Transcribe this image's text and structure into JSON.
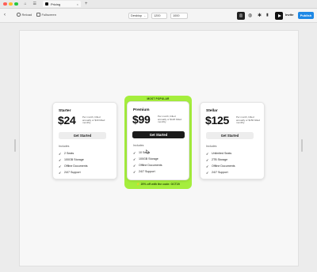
{
  "window": {
    "traffic_colors": [
      "#ff5f57",
      "#febc2e",
      "#28c840"
    ],
    "tab_title": "Pricing"
  },
  "toolbar": {
    "reload_label": "Reload",
    "fullscreen_label": "Fullscreen",
    "device_select": "Desktop",
    "width_value": "1200",
    "height_value": "1000",
    "invite_label": "Invite",
    "publish_label": "Publish",
    "publish_color": "#1e88e5"
  },
  "plans": [
    {
      "name": "Starter",
      "price": "$24",
      "note": "Per month, billed annually or $40 billed monthly",
      "cta": "Get Started",
      "includes_label": "Includes",
      "features": [
        "2 Seats",
        "100GB Storage",
        "Offline Documents",
        "24/7 Support"
      ]
    },
    {
      "name": "Premium",
      "price": "$99",
      "note": "Per month, billed annually or $120 billed monthly",
      "cta": "Get Started",
      "includes_label": "Includes",
      "features": [
        "10 Seats",
        "100GB Storage",
        "Offline Documents",
        "24/7 Support"
      ]
    },
    {
      "name": "Stellar",
      "price": "$125",
      "note": "Per month, billed annually or $150 billed monthly",
      "cta": "Get Started",
      "includes_label": "Includes",
      "features": [
        "Unlimited Seats",
        "2TB Storage",
        "Offline Documents",
        "24/7 Support"
      ]
    }
  ],
  "popular": {
    "label": "MOST POPULAR",
    "promo": "⚡ 20% off with the code: OCT20",
    "accent_color": "#a5ee3d"
  }
}
